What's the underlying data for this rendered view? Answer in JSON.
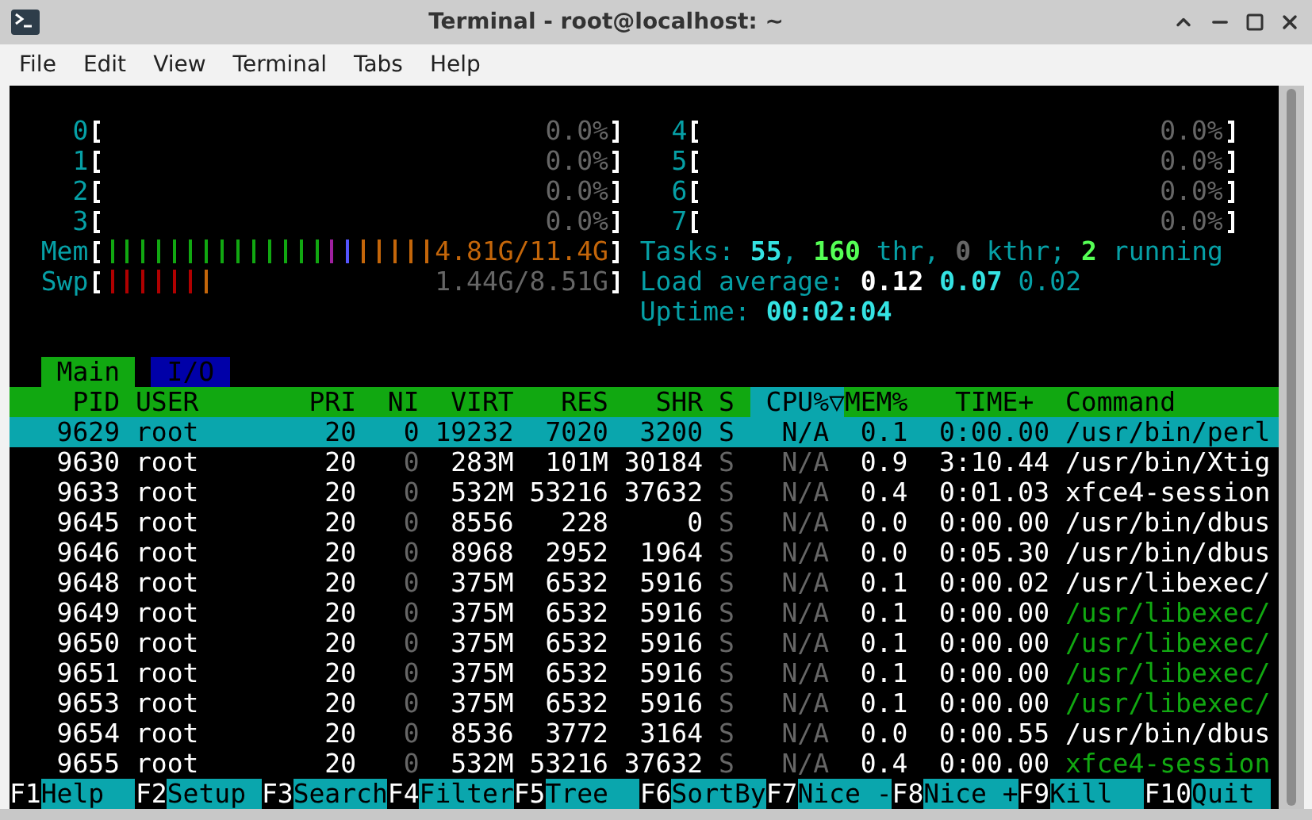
{
  "window": {
    "title": "Terminal - root@localhost: ~"
  },
  "menu": [
    "File",
    "Edit",
    "View",
    "Terminal",
    "Tabs",
    "Help"
  ],
  "meters_left": [
    {
      "kind": "cpu",
      "label": "0",
      "reading": "0.0%"
    },
    {
      "kind": "cpu",
      "label": "1",
      "reading": "0.0%"
    },
    {
      "kind": "cpu",
      "label": "2",
      "reading": "0.0%"
    },
    {
      "kind": "cpu",
      "label": "3",
      "reading": "0.0%"
    },
    {
      "kind": "memory",
      "label": "Mem",
      "reading": "4.81G/11.4G",
      "bars": [
        {
          "color": "#11a811"
        },
        {
          "color": "#11a811"
        },
        {
          "color": "#11a811"
        },
        {
          "color": "#11a811"
        },
        {
          "color": "#11a811"
        },
        {
          "color": "#11a811"
        },
        {
          "color": "#11a811"
        },
        {
          "color": "#11a811"
        },
        {
          "color": "#11a811"
        },
        {
          "color": "#11a811"
        },
        {
          "color": "#11a811"
        },
        {
          "color": "#11a811"
        },
        {
          "color": "#11a811"
        },
        {
          "color": "#11a811"
        },
        {
          "color": "#a020a0"
        },
        {
          "color": "#5555ff"
        },
        {
          "color": "#c4660a"
        },
        {
          "color": "#c4660a"
        },
        {
          "color": "#c4660a"
        },
        {
          "color": "#c4660a"
        },
        {
          "color": "#c4660a"
        }
      ]
    },
    {
      "kind": "swap",
      "label": "Swp",
      "reading": "1.44G/8.51G",
      "bars": [
        {
          "color": "#b00000"
        },
        {
          "color": "#b00000"
        },
        {
          "color": "#b00000"
        },
        {
          "color": "#b00000"
        },
        {
          "color": "#b00000"
        },
        {
          "color": "#b00000"
        },
        {
          "color": "#c4660a"
        }
      ]
    }
  ],
  "meters_right": [
    {
      "kind": "cpu",
      "label": "4",
      "reading": "0.0%"
    },
    {
      "kind": "cpu",
      "label": "5",
      "reading": "0.0%"
    },
    {
      "kind": "cpu",
      "label": "6",
      "reading": "0.0%"
    },
    {
      "kind": "cpu",
      "label": "7",
      "reading": "0.0%"
    }
  ],
  "summary": [
    {
      "parts": [
        {
          "text": "Tasks: ",
          "kind": "label"
        },
        {
          "text": "55",
          "kind": "bright"
        },
        {
          "text": ", ",
          "kind": "label"
        },
        {
          "text": "160",
          "kind": "green"
        },
        {
          "text": " thr, ",
          "kind": "label"
        },
        {
          "text": "0",
          "kind": "dim"
        },
        {
          "text": " kthr; ",
          "kind": "label"
        },
        {
          "text": "2",
          "kind": "green"
        },
        {
          "text": " running",
          "kind": "label"
        }
      ]
    },
    {
      "parts": [
        {
          "text": "Load average: ",
          "kind": "label"
        },
        {
          "text": "0.12",
          "kind": "white"
        },
        {
          "text": " 0.07",
          "kind": "bright"
        },
        {
          "text": " 0.02",
          "kind": "label"
        }
      ]
    },
    {
      "parts": [
        {
          "text": "Uptime: ",
          "kind": "label"
        },
        {
          "text": "00:02:04",
          "kind": "bright"
        }
      ]
    }
  ],
  "tabs": [
    {
      "label": "Main",
      "selected": true
    },
    {
      "label": "I/O",
      "selected": false
    }
  ],
  "columns": [
    {
      "label": "PID",
      "sorted": false
    },
    {
      "label": "USER",
      "sorted": false
    },
    {
      "label": "PRI",
      "sorted": false
    },
    {
      "label": "NI",
      "sorted": false
    },
    {
      "label": "VIRT",
      "sorted": false
    },
    {
      "label": "RES",
      "sorted": false
    },
    {
      "label": "SHR",
      "sorted": false
    },
    {
      "label": "S",
      "sorted": false
    },
    {
      "label": "CPU%▽",
      "sorted": true
    },
    {
      "label": "MEM%",
      "sorted": false
    },
    {
      "label": "TIME+",
      "sorted": false
    },
    {
      "label": "Command",
      "sorted": false
    }
  ],
  "rows": [
    {
      "selected": true,
      "cells": [
        "9629",
        "root",
        "20",
        "0",
        "19232",
        "7020",
        "3200",
        "S",
        "N/A",
        "0.1",
        "0:00.00",
        "/usr/bin/perl"
      ]
    },
    {
      "selected": false,
      "thread": false,
      "cells": [
        "9630",
        "root",
        "20",
        "0",
        "283M",
        "101M",
        "30184",
        "S",
        "N/A",
        "0.9",
        "3:10.44",
        "/usr/bin/Xtig"
      ]
    },
    {
      "selected": false,
      "thread": false,
      "cells": [
        "9633",
        "root",
        "20",
        "0",
        "532M",
        "53216",
        "37632",
        "S",
        "N/A",
        "0.4",
        "0:01.03",
        "xfce4-session"
      ]
    },
    {
      "selected": false,
      "thread": false,
      "cells": [
        "9645",
        "root",
        "20",
        "0",
        "8556",
        "228",
        "0",
        "S",
        "N/A",
        "0.0",
        "0:00.00",
        "/usr/bin/dbus"
      ]
    },
    {
      "selected": false,
      "thread": false,
      "cells": [
        "9646",
        "root",
        "20",
        "0",
        "8968",
        "2952",
        "1964",
        "S",
        "N/A",
        "0.0",
        "0:05.30",
        "/usr/bin/dbus"
      ]
    },
    {
      "selected": false,
      "thread": false,
      "cells": [
        "9648",
        "root",
        "20",
        "0",
        "375M",
        "6532",
        "5916",
        "S",
        "N/A",
        "0.1",
        "0:00.02",
        "/usr/libexec/"
      ]
    },
    {
      "selected": false,
      "thread": true,
      "cells": [
        "9649",
        "root",
        "20",
        "0",
        "375M",
        "6532",
        "5916",
        "S",
        "N/A",
        "0.1",
        "0:00.00",
        "/usr/libexec/"
      ]
    },
    {
      "selected": false,
      "thread": true,
      "cells": [
        "9650",
        "root",
        "20",
        "0",
        "375M",
        "6532",
        "5916",
        "S",
        "N/A",
        "0.1",
        "0:00.00",
        "/usr/libexec/"
      ]
    },
    {
      "selected": false,
      "thread": true,
      "cells": [
        "9651",
        "root",
        "20",
        "0",
        "375M",
        "6532",
        "5916",
        "S",
        "N/A",
        "0.1",
        "0:00.00",
        "/usr/libexec/"
      ]
    },
    {
      "selected": false,
      "thread": true,
      "cells": [
        "9653",
        "root",
        "20",
        "0",
        "375M",
        "6532",
        "5916",
        "S",
        "N/A",
        "0.1",
        "0:00.00",
        "/usr/libexec/"
      ]
    },
    {
      "selected": false,
      "thread": false,
      "cells": [
        "9654",
        "root",
        "20",
        "0",
        "8536",
        "3772",
        "3164",
        "S",
        "N/A",
        "0.0",
        "0:00.55",
        "/usr/bin/dbus"
      ]
    },
    {
      "selected": false,
      "thread": true,
      "cells": [
        "9655",
        "root",
        "20",
        "0",
        "532M",
        "53216",
        "37632",
        "S",
        "N/A",
        "0.4",
        "0:00.00",
        "xfce4-session"
      ]
    }
  ],
  "function_keys": [
    {
      "key": "F1",
      "label": "Help"
    },
    {
      "key": "F2",
      "label": "Setup"
    },
    {
      "key": "F3",
      "label": "Search"
    },
    {
      "key": "F4",
      "label": "Filter"
    },
    {
      "key": "F5",
      "label": "Tree"
    },
    {
      "key": "F6",
      "label": "SortBy"
    },
    {
      "key": "F7",
      "label": "Nice -"
    },
    {
      "key": "F8",
      "label": "Nice +"
    },
    {
      "key": "F9",
      "label": "Kill"
    },
    {
      "key": "F10",
      "label": "Quit"
    }
  ]
}
